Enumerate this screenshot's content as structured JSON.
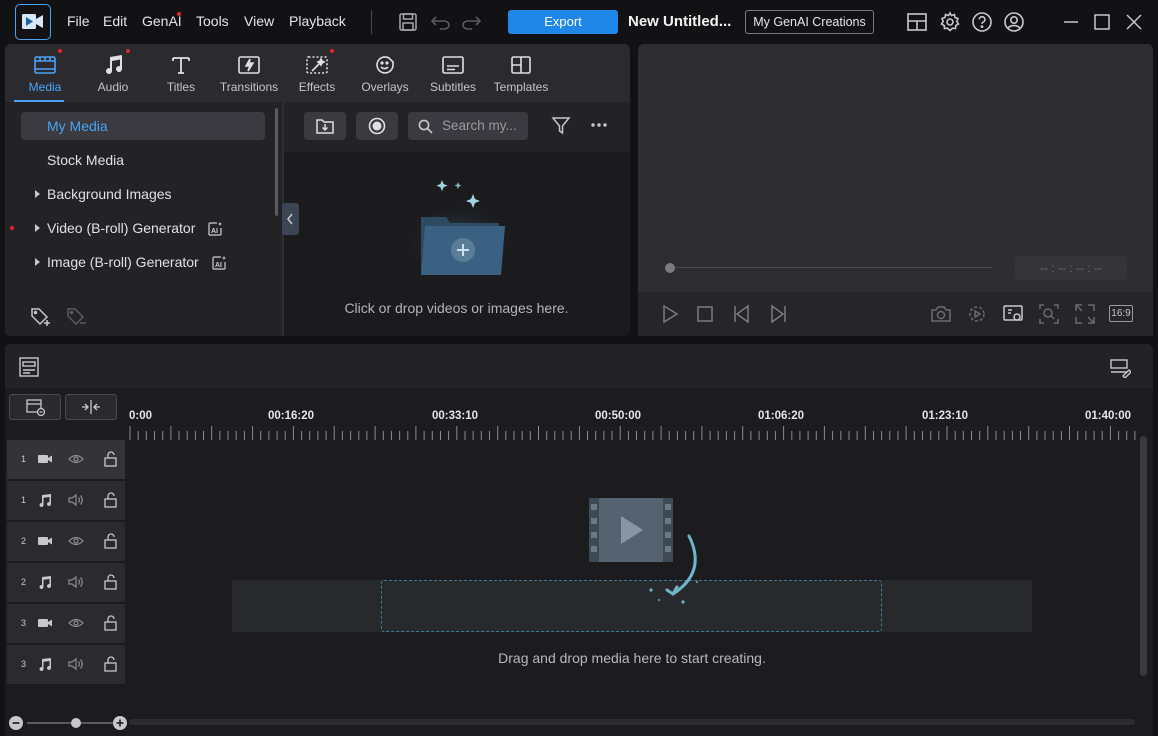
{
  "menu": {
    "items": [
      "File",
      "Edit",
      "GenAI",
      "Tools",
      "View",
      "Playback"
    ],
    "export_label": "Export",
    "project_title": "New Untitled...",
    "genai_creations_label": "My GenAI Creations"
  },
  "tabs": [
    "Media",
    "Audio",
    "Titles",
    "Transitions",
    "Effects",
    "Overlays",
    "Subtitles",
    "Templates"
  ],
  "active_tab": "Media",
  "sidebar": {
    "items": [
      {
        "label": "My Media",
        "expandable": false,
        "ai": false
      },
      {
        "label": "Stock Media",
        "expandable": false,
        "ai": false
      },
      {
        "label": "Background Images",
        "expandable": true,
        "ai": false
      },
      {
        "label": "Video (B-roll) Generator",
        "expandable": true,
        "ai": true
      },
      {
        "label": "Image (B-roll) Generator",
        "expandable": true,
        "ai": true
      }
    ]
  },
  "library": {
    "search_placeholder": "Search my...",
    "drop_hint": "Click or drop videos or images here."
  },
  "preview": {
    "timecode": "-- : -- : -- : --",
    "aspect_ratio": "16:9"
  },
  "timeline": {
    "ticks": [
      "0:00",
      "00:16:20",
      "00:33:10",
      "00:50:00",
      "01:06:20",
      "01:23:10",
      "01:40:00"
    ],
    "tracks": [
      {
        "number": "1",
        "type": "video"
      },
      {
        "number": "1",
        "type": "audio"
      },
      {
        "number": "2",
        "type": "video"
      },
      {
        "number": "2",
        "type": "audio"
      },
      {
        "number": "3",
        "type": "video"
      },
      {
        "number": "3",
        "type": "audio"
      }
    ],
    "drop_hint": "Drag and drop media here to start creating."
  },
  "colors": {
    "accent": "#4aa3f5",
    "export": "#1f87e8",
    "notification_dot": "#e6252b"
  }
}
